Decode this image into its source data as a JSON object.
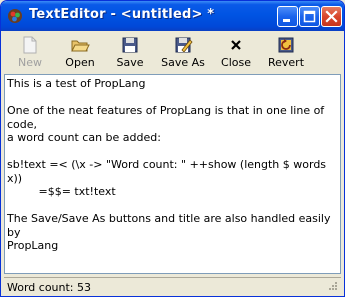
{
  "window": {
    "title": "TextEditor - <untitled> *"
  },
  "toolbar": {
    "buttons": [
      {
        "label": "New",
        "icon": "new-document-icon",
        "enabled": false
      },
      {
        "label": "Open",
        "icon": "open-folder-icon",
        "enabled": true
      },
      {
        "label": "Save",
        "icon": "floppy-disk-icon",
        "enabled": true
      },
      {
        "label": "Save As",
        "icon": "save-as-icon",
        "enabled": true
      },
      {
        "label": "Close",
        "icon": "close-x-icon",
        "enabled": true
      },
      {
        "label": "Revert",
        "icon": "revert-icon",
        "enabled": true
      }
    ]
  },
  "editor": {
    "lines": [
      "This is a test of PropLang",
      "",
      "One of the neat features of PropLang is that in one line of code,",
      "a word count can be added:",
      "",
      "sb!text =< (\\x -> \"Word count: \" ++show (length $ words x))",
      "         =$$= txt!text",
      "",
      "The Save/Save As buttons and title are also handled easily by",
      "PropLang"
    ]
  },
  "status": {
    "text": "Word count: 53"
  },
  "colors": {
    "titlebar": "#0054e3",
    "chrome": "#ece9d8",
    "close": "#d9462c"
  }
}
